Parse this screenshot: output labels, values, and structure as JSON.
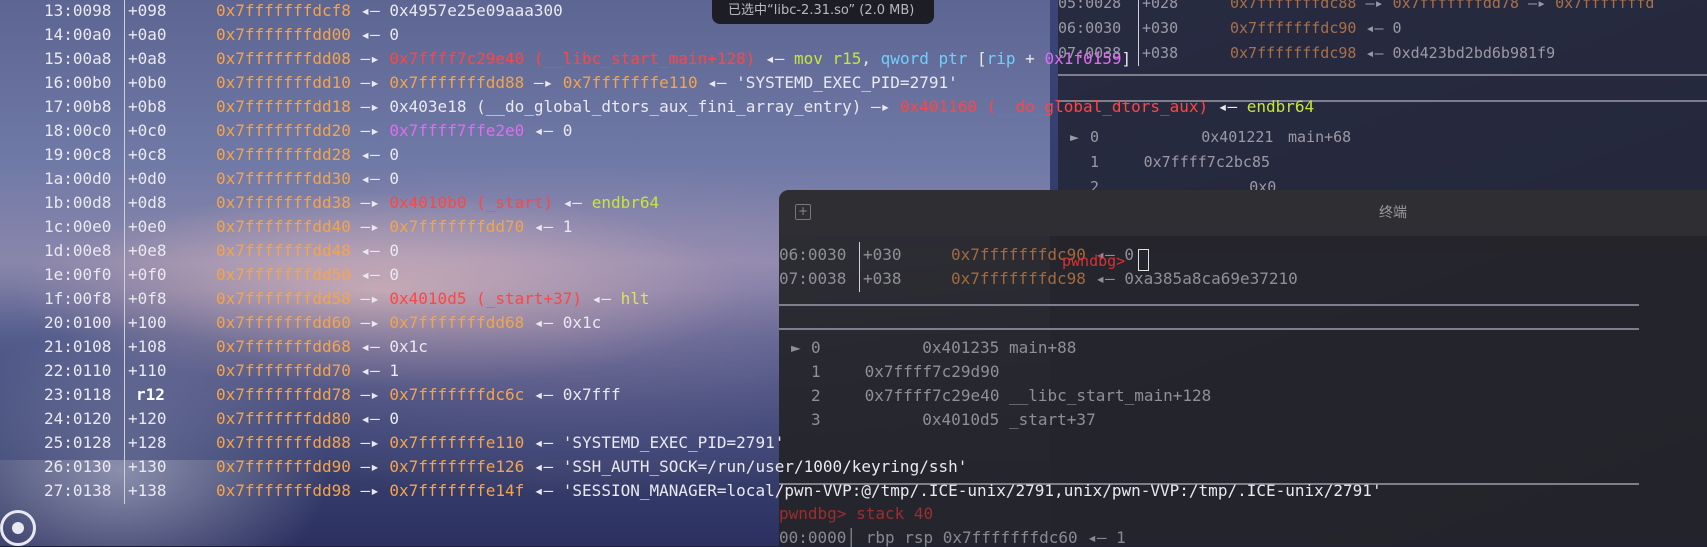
{
  "selection_notice": "已选中“libc-2.31.so” (2.0 MB)",
  "stack_rows": [
    {
      "addr": "13:0098",
      "off": "+098",
      "reg": false,
      "parts": [
        [
          "o",
          "0x7fffffffdcf8"
        ],
        [
          "w",
          " ◂— 0x4957e25e09aaa300"
        ]
      ]
    },
    {
      "addr": "14:00a0",
      "off": "+0a0",
      "reg": false,
      "parts": [
        [
          "o",
          "0x7fffffffdd00"
        ],
        [
          "w",
          " ◂— 0"
        ]
      ]
    },
    {
      "addr": "15:00a8",
      "off": "+0a8",
      "reg": false,
      "parts": [
        [
          "o",
          "0x7fffffffdd08"
        ],
        [
          "w",
          " —▸ "
        ],
        [
          "r",
          "0x7ffff7c29e40 (__libc_start_main+128)"
        ],
        [
          "w",
          " ◂— "
        ],
        [
          "g",
          "mov r15"
        ],
        [
          "w",
          ", "
        ],
        [
          "c",
          "qword ptr"
        ],
        [
          "w",
          " ["
        ],
        [
          "c",
          "rip"
        ],
        [
          "w",
          " + "
        ],
        [
          "m",
          "0x1f0159"
        ],
        [
          "w",
          "]"
        ]
      ]
    },
    {
      "addr": "16:00b0",
      "off": "+0b0",
      "reg": false,
      "parts": [
        [
          "o",
          "0x7fffffffdd10"
        ],
        [
          "w",
          " —▸ "
        ],
        [
          "o",
          "0x7fffffffdd88"
        ],
        [
          "w",
          " —▸ "
        ],
        [
          "o",
          "0x7fffffffe110"
        ],
        [
          "w",
          " ◂— 'SYSTEMD_EXEC_PID=2791'"
        ]
      ]
    },
    {
      "addr": "17:00b8",
      "off": "+0b8",
      "reg": false,
      "parts": [
        [
          "o",
          "0x7fffffffdd18"
        ],
        [
          "w",
          " —▸ 0x403e18 (__do_global_dtors_aux_fini_array_entry) —▸ "
        ],
        [
          "r",
          "0x401160 (__do_global_dtors_aux)"
        ],
        [
          "w",
          " ◂— "
        ],
        [
          "g",
          "endbr64"
        ]
      ]
    },
    {
      "addr": "18:00c0",
      "off": "+0c0",
      "reg": false,
      "parts": [
        [
          "o",
          "0x7fffffffdd20"
        ],
        [
          "w",
          " —▸ "
        ],
        [
          "m",
          "0x7ffff7ffe2e0"
        ],
        [
          "w",
          " ◂— 0"
        ]
      ]
    },
    {
      "addr": "19:00c8",
      "off": "+0c8",
      "reg": false,
      "parts": [
        [
          "o",
          "0x7fffffffdd28"
        ],
        [
          "w",
          " ◂— 0"
        ]
      ]
    },
    {
      "addr": "1a:00d0",
      "off": "+0d0",
      "reg": false,
      "parts": [
        [
          "o",
          "0x7fffffffdd30"
        ],
        [
          "w",
          " ◂— 0"
        ]
      ]
    },
    {
      "addr": "1b:00d8",
      "off": "+0d8",
      "reg": false,
      "parts": [
        [
          "o",
          "0x7fffffffdd38"
        ],
        [
          "w",
          " —▸ "
        ],
        [
          "r",
          "0x4010b0 (_start)"
        ],
        [
          "w",
          " ◂— "
        ],
        [
          "g",
          "endbr64"
        ]
      ]
    },
    {
      "addr": "1c:00e0",
      "off": "+0e0",
      "reg": false,
      "parts": [
        [
          "o",
          "0x7fffffffdd40"
        ],
        [
          "w",
          " —▸ "
        ],
        [
          "o",
          "0x7fffffffdd70"
        ],
        [
          "w",
          " ◂— 1"
        ]
      ]
    },
    {
      "addr": "1d:00e8",
      "off": "+0e8",
      "reg": false,
      "parts": [
        [
          "o",
          "0x7fffffffdd48"
        ],
        [
          "w",
          " ◂— 0"
        ]
      ]
    },
    {
      "addr": "1e:00f0",
      "off": "+0f0",
      "reg": false,
      "parts": [
        [
          "o",
          "0x7fffffffdd50"
        ],
        [
          "w",
          " ◂— 0"
        ]
      ]
    },
    {
      "addr": "1f:00f8",
      "off": "+0f8",
      "reg": false,
      "parts": [
        [
          "o",
          "0x7fffffffdd58"
        ],
        [
          "w",
          " —▸ "
        ],
        [
          "r",
          "0x4010d5 (_start+37)"
        ],
        [
          "w",
          " ◂— "
        ],
        [
          "y",
          "hlt"
        ]
      ]
    },
    {
      "addr": "20:0100",
      "off": "+100",
      "reg": false,
      "parts": [
        [
          "o",
          "0x7fffffffdd60"
        ],
        [
          "w",
          " —▸ "
        ],
        [
          "o",
          "0x7fffffffdd68"
        ],
        [
          "w",
          " ◂— 0x1c"
        ]
      ]
    },
    {
      "addr": "21:0108",
      "off": "+108",
      "reg": false,
      "parts": [
        [
          "o",
          "0x7fffffffdd68"
        ],
        [
          "w",
          " ◂— 0x1c"
        ]
      ]
    },
    {
      "addr": "22:0110",
      "off": "+110",
      "reg": false,
      "parts": [
        [
          "o",
          "0x7fffffffdd70"
        ],
        [
          "w",
          " ◂— 1"
        ]
      ]
    },
    {
      "addr": "23:0118",
      "off": "r12",
      "reg": true,
      "parts": [
        [
          "o",
          "0x7fffffffdd78"
        ],
        [
          "w",
          " —▸ "
        ],
        [
          "o",
          "0x7fffffffdc6c"
        ],
        [
          "w",
          " ◂— 0x7fff"
        ]
      ]
    },
    {
      "addr": "24:0120",
      "off": "+120",
      "reg": false,
      "parts": [
        [
          "o",
          "0x7fffffffdd80"
        ],
        [
          "w",
          " ◂— 0"
        ]
      ]
    },
    {
      "addr": "25:0128",
      "off": "+128",
      "reg": false,
      "parts": [
        [
          "o",
          "0x7fffffffdd88"
        ],
        [
          "w",
          " —▸ "
        ],
        [
          "o",
          "0x7fffffffe110"
        ],
        [
          "w",
          " ◂— 'SYSTEMD_EXEC_PID=2791'"
        ]
      ]
    },
    {
      "addr": "26:0130",
      "off": "+130",
      "reg": false,
      "parts": [
        [
          "o",
          "0x7fffffffdd90"
        ],
        [
          "w",
          " —▸ "
        ],
        [
          "o",
          "0x7fffffffe126"
        ],
        [
          "w",
          " ◂— 'SSH_AUTH_SOCK=/run/user/1000/keyring/ssh'"
        ]
      ]
    },
    {
      "addr": "27:0138",
      "off": "+138",
      "reg": false,
      "parts": [
        [
          "o",
          "0x7fffffffdd98"
        ],
        [
          "w",
          " —▸ "
        ],
        [
          "o",
          "0x7fffffffe14f"
        ],
        [
          "w",
          " ◂— 'SESSION_MANAGER=local/pwn-VVP:@/tmp/.ICE-unix/2791,unix/pwn-VVP:/tmp/.ICE-unix/2791'"
        ]
      ]
    }
  ],
  "top_pane": {
    "rows": [
      {
        "addr": "05:0028",
        "off": "+028",
        "parts": [
          [
            "o",
            "0x7fffffffdc88"
          ],
          [
            "w",
            " —▸ "
          ],
          [
            "o",
            "0x7fffffffdd78"
          ],
          [
            "w",
            " —▸ "
          ],
          [
            "o",
            "0x7fffffffd"
          ]
        ]
      },
      {
        "addr": "06:0030",
        "off": "+030",
        "parts": [
          [
            "o",
            "0x7fffffffdc90"
          ],
          [
            "w",
            " ◂— 0"
          ]
        ]
      },
      {
        "addr": "07:0038",
        "off": "+038",
        "parts": [
          [
            "o",
            "0x7fffffffdc98"
          ],
          [
            "w",
            " ◂— 0xd423bd2bd6b981f9"
          ]
        ]
      }
    ],
    "backtrace": [
      {
        "marker": "►",
        "idx": "0",
        "addr": "0x401221",
        "sym": "main+68"
      },
      {
        "marker": "",
        "idx": "1",
        "addr": "0x7ffff7c2bc85",
        "sym": ""
      },
      {
        "marker": "",
        "idx": "2",
        "addr": "0x0",
        "sym": ""
      }
    ],
    "prompt": "pwndbg>"
  },
  "terminal": {
    "title": "终端",
    "rows": [
      {
        "addr": "06:0030",
        "off": "+030",
        "parts": [
          [
            "o",
            "0x7fffffffdc90"
          ],
          [
            "w",
            " ◂— 0"
          ]
        ]
      },
      {
        "addr": "07:0038",
        "off": "+038",
        "parts": [
          [
            "o",
            "0x7fffffffdc98"
          ],
          [
            "w",
            " ◂— 0xa385a8ca69e37210"
          ]
        ]
      }
    ],
    "backtrace": [
      {
        "marker": "►",
        "idx": "0",
        "addr": "0x401235",
        "sym": "main+88"
      },
      {
        "marker": "",
        "idx": "1",
        "addr": "0x7ffff7c29d90",
        "sym": ""
      },
      {
        "marker": "",
        "idx": "2",
        "addr": "0x7ffff7c29e40",
        "sym": "__libc_start_main+128"
      },
      {
        "marker": "",
        "idx": "3",
        "addr": "0x4010d5",
        "sym": "_start+37"
      }
    ],
    "ghost_cmd": "pwndbg> stack 40",
    "ghost_last": "00:0000│ rbp rsp 0x7fffffffdc60 ◂— 1"
  }
}
